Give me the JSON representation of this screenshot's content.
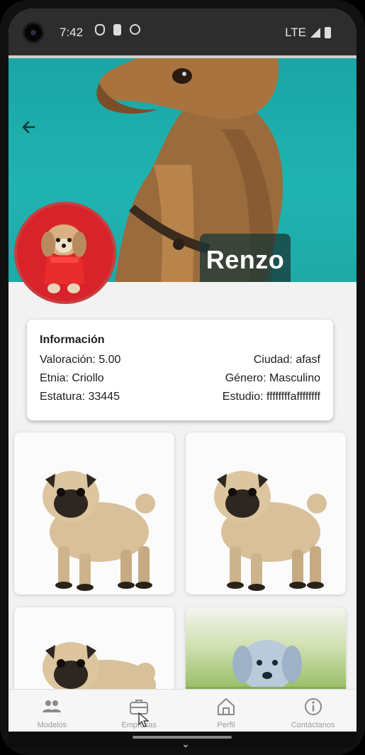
{
  "status_bar": {
    "time": "7:42",
    "network": "LTE"
  },
  "profile": {
    "name": "Renzo",
    "back_icon": "arrow-left-icon"
  },
  "info": {
    "title": "Información",
    "rows": [
      {
        "left": "Valoración: 5.00",
        "right": "Ciudad: afasf"
      },
      {
        "left": "Etnia: Criollo",
        "right": "Género: Masculino"
      },
      {
        "left": "Estatura: 33445",
        "right": "Estudio: ffffffffaffffffff"
      }
    ]
  },
  "nav": {
    "items": [
      {
        "label": "Modelos",
        "icon": "people-icon"
      },
      {
        "label": "Empresas",
        "icon": "briefcase-icon"
      },
      {
        "label": "Perfil",
        "icon": "home-icon"
      },
      {
        "label": "Contáctanos",
        "icon": "info-icon"
      }
    ]
  },
  "colors": {
    "banner": "#1ea9a7",
    "avatar_bg": "#d8232a"
  }
}
